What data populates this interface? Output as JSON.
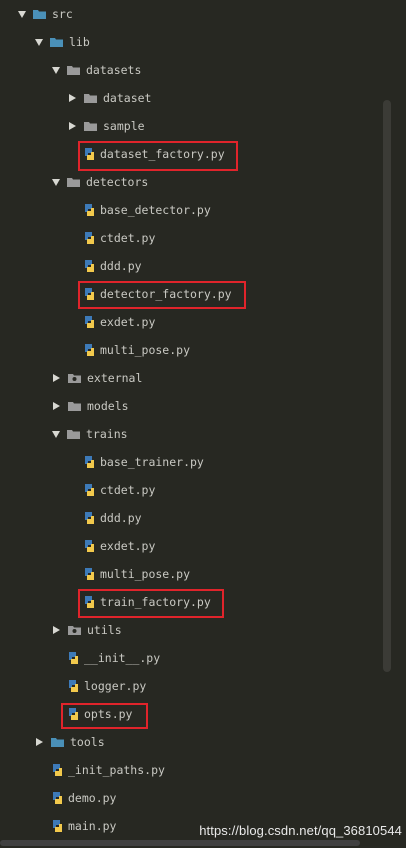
{
  "tree": {
    "src": "src",
    "lib": "lib",
    "datasets": "datasets",
    "dataset": "dataset",
    "sample": "sample",
    "dataset_factory": "dataset_factory.py",
    "detectors": "detectors",
    "base_detector": "base_detector.py",
    "ctdet_det": "ctdet.py",
    "ddd_det": "ddd.py",
    "detector_factory": "detector_factory.py",
    "exdet_det": "exdet.py",
    "multi_pose_det": "multi_pose.py",
    "external": "external",
    "models": "models",
    "trains": "trains",
    "base_trainer": "base_trainer.py",
    "ctdet_tr": "ctdet.py",
    "ddd_tr": "ddd.py",
    "exdet_tr": "exdet.py",
    "multi_pose_tr": "multi_pose.py",
    "train_factory": "train_factory.py",
    "utils": "utils",
    "init": "__init__.py",
    "logger": "logger.py",
    "opts": "opts.py",
    "tools": "tools",
    "init_paths": "_init_paths.py",
    "demo": "demo.py",
    "main": "main.py"
  },
  "watermark": "https://blog.csdn.net/qq_36810544",
  "colors": {
    "background": "#272822",
    "highlight": "#e0242b",
    "folder_blue": "#4a90b8",
    "folder_grey": "#9a9a9a",
    "python_blue": "#3d7ab8",
    "python_yellow": "#f2c94c"
  },
  "icons": {
    "folder_open": "folder-open-icon",
    "folder_closed": "folder-icon",
    "package_folder": "package-folder-icon",
    "python_file": "python-file-icon",
    "arrow_open": "chevron-down-icon",
    "arrow_closed": "chevron-right-icon"
  }
}
